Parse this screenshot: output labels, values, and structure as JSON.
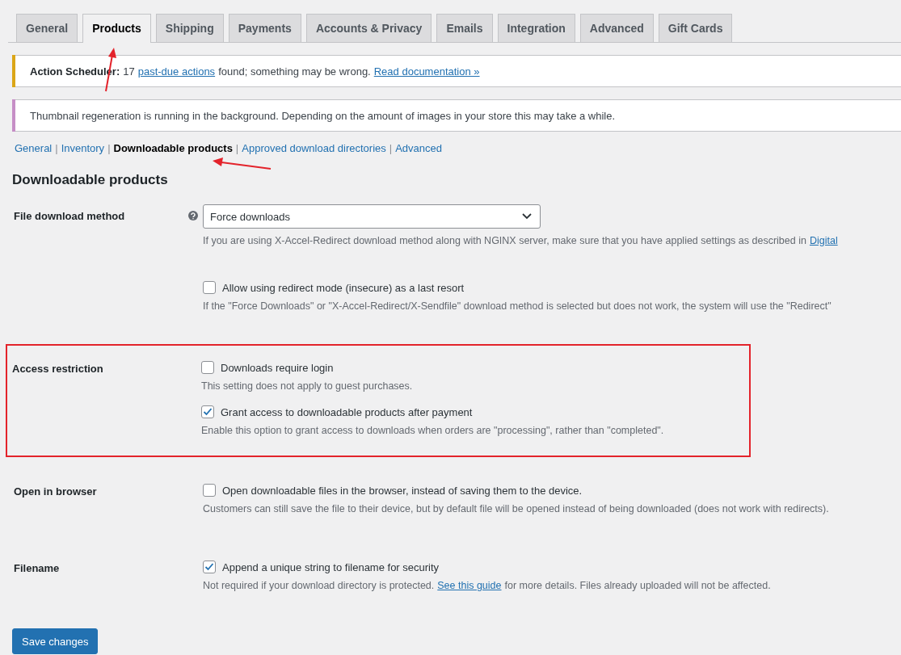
{
  "tabs": [
    {
      "label": "General",
      "selected": false
    },
    {
      "label": "Products",
      "selected": true
    },
    {
      "label": "Shipping",
      "selected": false
    },
    {
      "label": "Payments",
      "selected": false
    },
    {
      "label": "Accounts & Privacy",
      "selected": false
    },
    {
      "label": "Emails",
      "selected": false
    },
    {
      "label": "Integration",
      "selected": false
    },
    {
      "label": "Advanced",
      "selected": false
    },
    {
      "label": "Gift Cards",
      "selected": false
    }
  ],
  "notices": [
    {
      "color": "#dba617",
      "parts": [
        {
          "kind": "bold",
          "text": "Action Scheduler:"
        },
        {
          "kind": "text",
          "text": "17"
        },
        {
          "kind": "link",
          "text": "past-due actions"
        },
        {
          "kind": "text",
          "text": "found; something may be wrong."
        },
        {
          "kind": "link",
          "text": "Read documentation »"
        }
      ]
    },
    {
      "color": "#c68ec6",
      "parts": [
        {
          "kind": "text",
          "text": "Thumbnail regeneration is running in the background. Depending on the amount of images in your store this may take a while."
        }
      ]
    }
  ],
  "subnav": [
    {
      "label": "General",
      "selected": false
    },
    {
      "separator": "|",
      "label": "Inventory",
      "selected": false
    },
    {
      "separator": "|",
      "label": "Downloadable products",
      "selected": true
    },
    {
      "separator": "|",
      "label": "Approved download directories",
      "selected": false
    },
    {
      "separator": "|",
      "label": "Advanced",
      "selected": false
    }
  ],
  "heading": "Downloadable products",
  "sections": [
    {
      "label": "File download method",
      "highlighted": false,
      "help": true,
      "items": [
        {
          "kind": "select",
          "value": "Force downloads"
        },
        {
          "kind": "description",
          "parts": [
            {
              "kind": "text",
              "text": "If you are using X-Accel-Redirect download method along with NGINX server, make sure that you have applied settings as described in"
            },
            {
              "kind": "link",
              "text": "Digital"
            }
          ]
        },
        {
          "kind": "spacer"
        },
        {
          "kind": "checkbox",
          "label": "Allow using redirect mode (insecure) as a last resort",
          "checked": false
        },
        {
          "kind": "description",
          "parts": [
            {
              "kind": "text",
              "text": "If the \"Force Downloads\" or \"X-Accel-Redirect/X-Sendfile\" download method is selected but does not work, the system will use the \"Redirect\""
            }
          ]
        }
      ]
    },
    {
      "label": "Access restriction",
      "highlighted": true,
      "help": false,
      "items": [
        {
          "kind": "checkbox",
          "label": "Downloads require login",
          "checked": false
        },
        {
          "kind": "description",
          "parts": [
            {
              "kind": "text",
              "text": "This setting does not apply to guest purchases."
            }
          ]
        },
        {
          "kind": "checkbox",
          "label": "Grant access to downloadable products after payment",
          "checked": true
        },
        {
          "kind": "description",
          "parts": [
            {
              "kind": "text",
              "text": "Enable this option to grant access to downloads when orders are \"processing\", rather than \"completed\"."
            }
          ]
        }
      ]
    },
    {
      "label": "Open in browser",
      "highlighted": false,
      "help": false,
      "items": [
        {
          "kind": "checkbox",
          "label": "Open downloadable files in the browser, instead of saving them to the device.",
          "checked": false
        },
        {
          "kind": "description",
          "parts": [
            {
              "kind": "text",
              "text": "Customers can still save the file to their device, but by default file will be opened instead of being downloaded (does not work with redirects)."
            }
          ]
        }
      ]
    },
    {
      "label": "Filename",
      "highlighted": false,
      "help": false,
      "items": [
        {
          "kind": "checkbox",
          "label": "Append a unique string to filename for security",
          "checked": true
        },
        {
          "kind": "description",
          "parts": [
            {
              "kind": "text",
              "text": "Not required if your download directory is protected."
            },
            {
              "kind": "link",
              "text": "See this guide"
            },
            {
              "kind": "text",
              "text": "for more details. Files already uploaded will not be affected."
            }
          ]
        }
      ]
    }
  ],
  "save_button": "Save changes"
}
